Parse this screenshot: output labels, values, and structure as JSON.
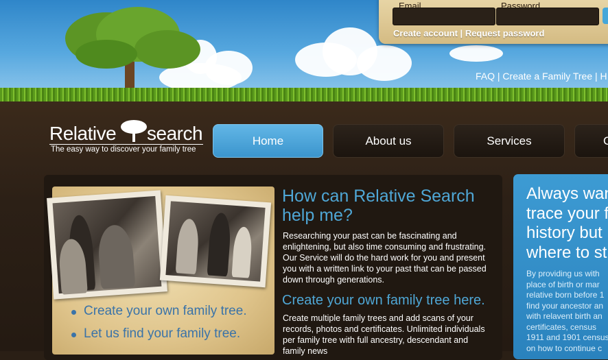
{
  "login": {
    "email_label": "Email",
    "password_label": "Password",
    "create_account": "Create account",
    "separator": "|",
    "request_password": "Request password"
  },
  "top_links": "FAQ | Create a Family Tree | H",
  "logo": {
    "name_left": "Relative",
    "name_right": "search",
    "tagline": "The easy way to discover your family tree"
  },
  "nav": {
    "items": [
      {
        "label": "Home",
        "active": true
      },
      {
        "label": "About us",
        "active": false
      },
      {
        "label": "Services",
        "active": false
      },
      {
        "label": "C",
        "active": false
      }
    ]
  },
  "main": {
    "heading": "How can Relative Search help me?",
    "intro": "Researching your past can be fascinating and enlightening, but also time consuming and frustrating. Our Service will do the hard work for you and present you with a written link to your past that can be passed down through generations.",
    "subheading": "Create your own family tree here.",
    "sub_text": "Create multiple family trees and add scans of your records, photos and certificates. Unlimited individuals per family tree with full ancestry, descendant and family news",
    "bullets": [
      "Create your own family tree.",
      "Let us find your family tree."
    ]
  },
  "side": {
    "heading": "Always wan\ntrace your f\nhistory but\nwhere to st",
    "text": "By providing us with\nplace of birth or mar\nrelative born before 1\nfind your ancestor an\nwith relavent birth an\ncertificates, census\n1911 and 1901 census\non how to continue c"
  },
  "colors": {
    "accent_blue": "#4fa7d6",
    "nav_active": "#3b95cd",
    "background_soil": "#2a1f15"
  }
}
